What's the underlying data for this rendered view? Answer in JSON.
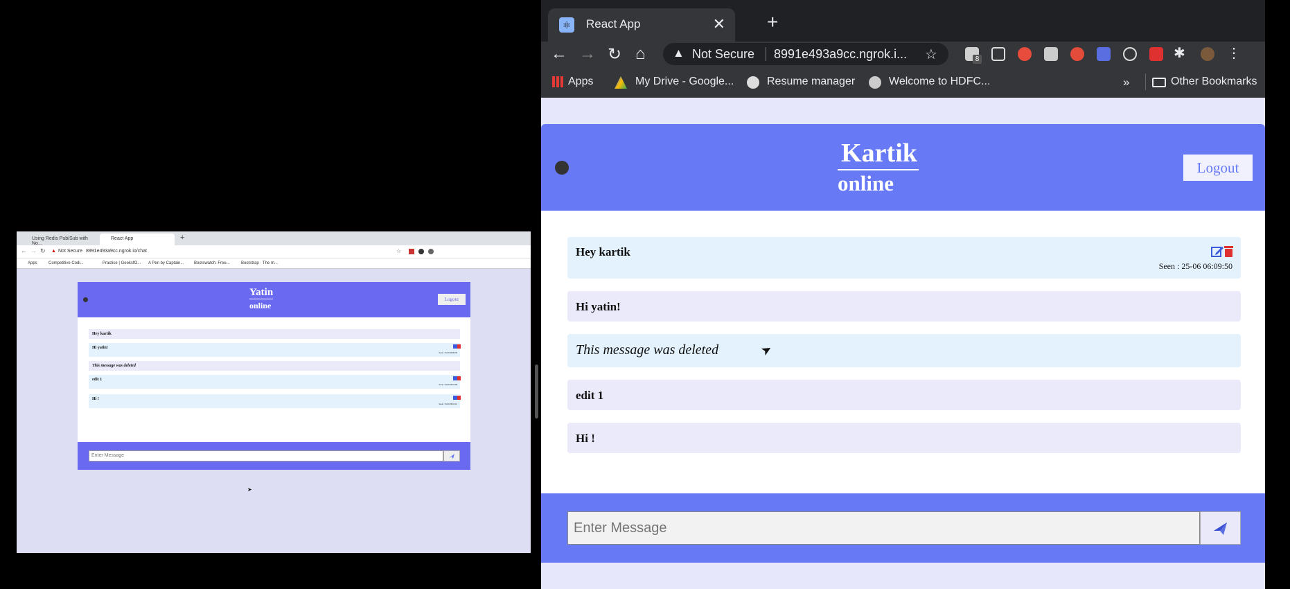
{
  "right_browser": {
    "tab_title": "React App",
    "tab_close": "✕",
    "new_tab": "+",
    "omnibox": {
      "security": "Not Secure",
      "url": "8991e493a9cc.ngrok.i..."
    },
    "extension_badge": "8",
    "bookmarks": [
      "Apps",
      "My Drive - Google...",
      "Resume manager",
      "Welcome to HDFC..."
    ],
    "bookmarks_overflow": "»",
    "other_bookmarks": "Other Bookmarks"
  },
  "right_chat": {
    "header": {
      "name": "Kartik",
      "status": "online",
      "logout_label": "Logout"
    },
    "messages": [
      {
        "text": "Hey kartik",
        "seen": "Seen : 25-06 06:09:50"
      },
      {
        "text": "Hi yatin!"
      },
      {
        "text": "This message was deleted"
      },
      {
        "text": "edit 1"
      },
      {
        "text": "Hi !"
      }
    ],
    "input_placeholder": "Enter Message"
  },
  "left_browser": {
    "tabs": [
      "Using Redis Pub/Sub with No...",
      "React App"
    ],
    "security": "Not Secure",
    "url": "8991e493a9cc.ngrok.io/chat",
    "bookmarks": [
      "Apps",
      "Competitive Codi...",
      "Practice | GeeksfO...",
      "A Pen by Captain...",
      "Bootswatch: Free...",
      "Bootstrap · The m..."
    ]
  },
  "left_chat": {
    "header": {
      "name": "Yatin",
      "status": "online",
      "logout_label": "Logout"
    },
    "messages": [
      {
        "text": "Hey kartik"
      },
      {
        "text": "Hi yatin!",
        "seen": "Seen : 25-06 06:09:50"
      },
      {
        "text": "This message was deleted"
      },
      {
        "text": "edit 1",
        "seen": "Seen : 25-06 06:10:06"
      },
      {
        "text": "Hi !",
        "seen": "Seen : 25-06 06:10:10"
      }
    ],
    "input_placeholder": "Enter Message"
  },
  "colors": {
    "header_blue": "#6779f5",
    "bubble_light_blue": "#e3f2fd",
    "bubble_lavender": "#eaeafb",
    "edit_icon": "#3b5bdb",
    "delete_icon": "#e03131"
  }
}
